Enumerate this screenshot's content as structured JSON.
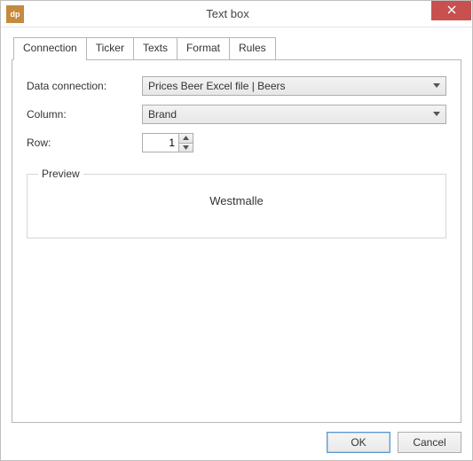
{
  "window": {
    "title": "Text box",
    "app_icon_text": "dp"
  },
  "tabs": [
    {
      "label": "Connection"
    },
    {
      "label": "Ticker"
    },
    {
      "label": "Texts"
    },
    {
      "label": "Format"
    },
    {
      "label": "Rules"
    }
  ],
  "form": {
    "data_connection_label": "Data connection:",
    "data_connection_value": "Prices Beer Excel file | Beers",
    "column_label": "Column:",
    "column_value": "Brand",
    "row_label": "Row:",
    "row_value": "1"
  },
  "preview": {
    "legend": "Preview",
    "value": "Westmalle"
  },
  "buttons": {
    "ok": "OK",
    "cancel": "Cancel"
  }
}
